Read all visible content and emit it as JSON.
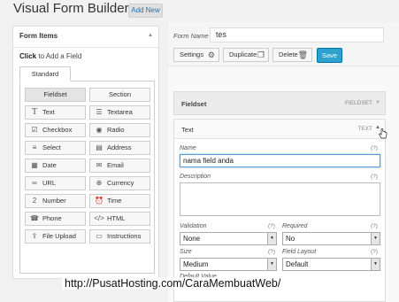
{
  "header": {
    "title": "Visual Form Builder",
    "add_new": "Add New"
  },
  "form_items": {
    "title": "Form Items",
    "click_bold": "Click",
    "click_rest": " to Add a Field",
    "tab": "Standard",
    "fields": [
      {
        "label": "Fieldset",
        "icon": "none"
      },
      {
        "label": "Section",
        "icon": "none"
      },
      {
        "label": "Text",
        "icon": "text-icon"
      },
      {
        "label": "Textarea",
        "icon": "textarea-icon"
      },
      {
        "label": "Checkbox",
        "icon": "checkbox-icon"
      },
      {
        "label": "Radio",
        "icon": "radio-icon"
      },
      {
        "label": "Select",
        "icon": "select-icon"
      },
      {
        "label": "Address",
        "icon": "address-icon"
      },
      {
        "label": "Date",
        "icon": "date-icon"
      },
      {
        "label": "Email",
        "icon": "email-icon"
      },
      {
        "label": "URL",
        "icon": "url-icon"
      },
      {
        "label": "Currency",
        "icon": "currency-icon"
      },
      {
        "label": "Number",
        "icon": "number-icon"
      },
      {
        "label": "Time",
        "icon": "time-icon"
      },
      {
        "label": "Phone",
        "icon": "phone-icon"
      },
      {
        "label": "HTML",
        "icon": "html-icon"
      },
      {
        "label": "File Upload",
        "icon": "file-upload-icon"
      },
      {
        "label": "Instructions",
        "icon": "instructions-icon"
      }
    ]
  },
  "form": {
    "name_label": "Form Name",
    "name_value": "tes",
    "settings": "Settings",
    "duplicate": "Duplicate",
    "delete": "Delete",
    "save": "Save"
  },
  "fieldset": {
    "title": "Fieldset",
    "type": "FIELDSET"
  },
  "text_field": {
    "title": "Text",
    "type": "TEXT",
    "help": "(?)",
    "name_label": "Name",
    "name_value": "nama field anda",
    "description_label": "Description",
    "validation_label": "Validation",
    "validation_value": "None",
    "required_label": "Required",
    "required_value": "No",
    "size_label": "Size",
    "size_value": "Medium",
    "layout_label": "Field Layout",
    "layout_value": "Default",
    "default_label": "Default Value"
  },
  "watermark": "http://PusatHosting.com/CaraMembuatWeb/",
  "colors": {
    "save": "#2ea2cc",
    "link": "#1e73be",
    "focus": "#5b9dd9"
  }
}
